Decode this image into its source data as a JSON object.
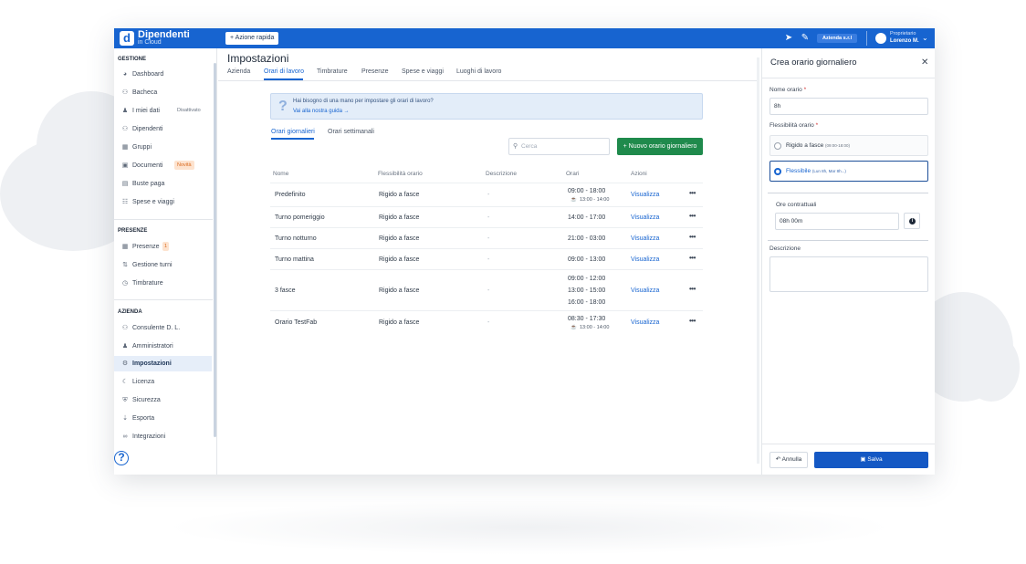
{
  "brand": {
    "name": "Dipendenti",
    "sub": "in Cloud",
    "logo_icon": "letter-d-logo"
  },
  "topbar": {
    "quick_action": "+ Azione rapida",
    "company": "Azienda s.r.l",
    "role": "Proprietario",
    "user": "Lorenzo M.",
    "icons": [
      "rocket-icon",
      "megaphone-icon",
      "chevron-down-icon"
    ]
  },
  "sidebar": {
    "sections": [
      {
        "title": "GESTIONE",
        "items": [
          {
            "label": "Dashboard",
            "icon": "gauge-icon"
          },
          {
            "label": "Bacheca",
            "icon": "people-icon"
          },
          {
            "label": "I miei dati",
            "icon": "user-icon",
            "badge": "Disattivato"
          },
          {
            "label": "Dipendenti",
            "icon": "users-icon"
          },
          {
            "label": "Gruppi",
            "icon": "group-icon"
          },
          {
            "label": "Documenti",
            "icon": "folder-icon",
            "badge": "Novità"
          },
          {
            "label": "Buste paga",
            "icon": "file-icon"
          },
          {
            "label": "Spese e viaggi",
            "icon": "receipt-icon"
          }
        ]
      },
      {
        "title": "PRESENZE",
        "items": [
          {
            "label": "Presenze",
            "icon": "calendar-icon",
            "badge": "1"
          },
          {
            "label": "Gestione turni",
            "icon": "shifts-icon"
          },
          {
            "label": "Timbrature",
            "icon": "clock-icon"
          }
        ]
      },
      {
        "title": "AZIENDA",
        "items": [
          {
            "label": "Consulente D. L.",
            "icon": "advisor-icon"
          },
          {
            "label": "Amministratori",
            "icon": "admin-icon"
          },
          {
            "label": "Impostazioni",
            "icon": "gears-icon",
            "active": true
          },
          {
            "label": "Licenza",
            "icon": "moon-icon"
          },
          {
            "label": "Sicurezza",
            "icon": "shield-icon"
          },
          {
            "label": "Esporta",
            "icon": "export-icon"
          },
          {
            "label": "Integrazioni",
            "icon": "link-icon"
          }
        ]
      }
    ],
    "help": "?"
  },
  "main": {
    "title": "Impostazioni",
    "tabs": [
      "Azienda",
      "Orari di lavoro",
      "Timbrature",
      "Presenze",
      "Spese e viaggi",
      "Luoghi di lavoro"
    ],
    "active_tab": "Orari di lavoro",
    "banner": {
      "text": "Hai bisogno di una mano per impostare gli orari di lavoro?",
      "link": "Vai alla nostra guida →"
    },
    "subtabs": [
      "Orari giornalieri",
      "Orari settimanali"
    ],
    "search_placeholder": "Cerca",
    "new_button": "+ Nuovo orario giornaliero",
    "columns": [
      "Nome",
      "Flessibilità orario",
      "Descrizione",
      "Orari",
      "Azioni"
    ],
    "rows": [
      {
        "name": "Predefinito",
        "flex": "Rigido a fasce",
        "desc": "-",
        "times": [
          "09:00 - 18:00"
        ],
        "break": "13:00 - 14:00",
        "action": "Visualizza"
      },
      {
        "name": "Turno pomeriggio",
        "flex": "Rigido a fasce",
        "desc": "-",
        "times": [
          "14:00 - 17:00"
        ],
        "action": "Visualizza"
      },
      {
        "name": "Turno notturno",
        "flex": "Rigido a fasce",
        "desc": "-",
        "times": [
          "21:00 - 03:00"
        ],
        "action": "Visualizza"
      },
      {
        "name": "Turno mattina",
        "flex": "Rigido a fasce",
        "desc": "-",
        "times": [
          "09:00 - 13:00"
        ],
        "action": "Visualizza"
      },
      {
        "name": "3 fasce",
        "flex": "Rigido a fasce",
        "desc": "-",
        "times": [
          "09:00 - 12:00",
          "13:00 - 15:00",
          "16:00 - 18:00"
        ],
        "action": "Visualizza"
      },
      {
        "name": "Orario TestFab",
        "flex": "Rigido a fasce",
        "desc": "-",
        "times": [
          "08:30 - 17:30"
        ],
        "break": "13:00 - 14:00",
        "action": "Visualizza"
      }
    ],
    "more": "•••"
  },
  "panel": {
    "title": "Crea orario giornaliero",
    "name_label": "Nome orario",
    "name_value": "8h",
    "flex_label": "Flessibilità orario",
    "options": [
      {
        "label": "Rigido a fasce",
        "hint": "(09:00-18:00)",
        "selected": false
      },
      {
        "label": "Flessibile",
        "hint": "(Lun 8h, Mar 8h...)",
        "selected": true
      }
    ],
    "hours_label": "Ore contrattuali",
    "hours_value": "08h 00m",
    "desc_label": "Descrizione",
    "desc_value": "",
    "cancel": "Annulla",
    "save": "Salva",
    "required_mark": "*"
  }
}
